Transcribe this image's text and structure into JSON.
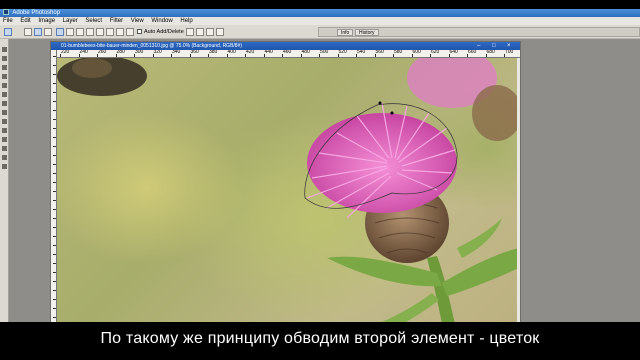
{
  "window": {
    "title": "Adobe Photoshop"
  },
  "menu": [
    "File",
    "Edit",
    "Image",
    "Layer",
    "Select",
    "Filter",
    "View",
    "Window",
    "Help"
  ],
  "options_bar": {
    "auto_add_delete_label": "Auto Add/Delete",
    "palette_tabs": [
      "Info",
      "History"
    ]
  },
  "document": {
    "title": "01-bumblebees-bite-bauer-minden_0051310.jpg @ 75.0% (Background, RGB/8#)",
    "ruler_h_labels": [
      "220",
      "240",
      "260",
      "280",
      "300",
      "320",
      "340",
      "360",
      "380",
      "400",
      "420",
      "440",
      "460",
      "480",
      "500",
      "520",
      "540",
      "560",
      "580",
      "600",
      "620",
      "640",
      "660",
      "680",
      "700"
    ]
  },
  "caption": {
    "text": "По такому же принципу обводим второй элемент - цветок"
  },
  "colors": {
    "flower": "#d64fb0",
    "stem": "#6f9a3a",
    "bud": "#8a6a4a",
    "title_bar": "#2f6fc0"
  }
}
